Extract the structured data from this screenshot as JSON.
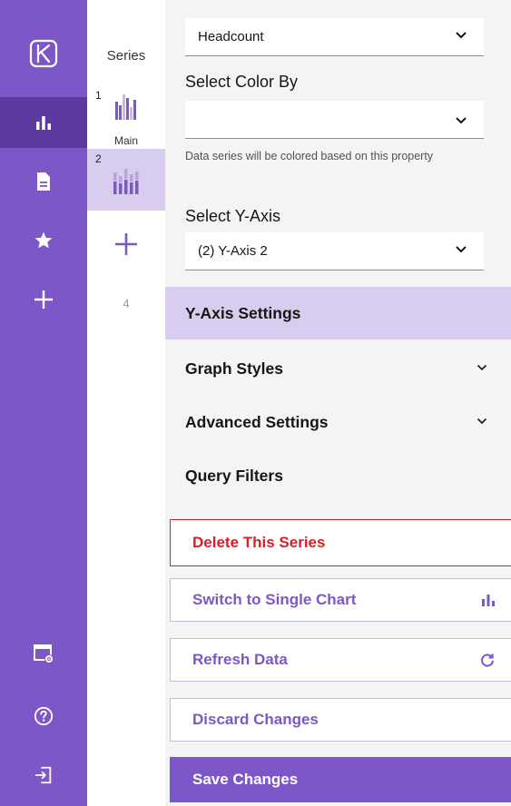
{
  "series_panel": {
    "title": "Series",
    "items": [
      {
        "number": "1",
        "sublabel": "Main",
        "icon": "bar-chart-thumbnail-icon"
      },
      {
        "number": "2",
        "sublabel": "",
        "icon": "bar-chart-thumbnail-icon"
      }
    ],
    "next_number": "4"
  },
  "settings": {
    "metric_select": {
      "value": "Headcount"
    },
    "color_by": {
      "label": "Select Color By",
      "value": "",
      "helper": "Data series will be colored based on this property"
    },
    "y_axis": {
      "label": "Select Y-Axis",
      "value": "(2) Y-Axis 2"
    }
  },
  "sections": {
    "y_axis_settings": "Y-Axis Settings",
    "graph_styles": "Graph Styles",
    "advanced_settings": "Advanced Settings",
    "query_filters": "Query Filters"
  },
  "actions": {
    "delete": "Delete This Series",
    "switch_single": "Switch to Single Chart",
    "refresh": "Refresh Data",
    "discard": "Discard Changes",
    "save": "Save Changes"
  },
  "colors": {
    "brand_purple": "#7d57c7",
    "rail_active": "#5b3aa0",
    "selected_lavender": "#d8cdee",
    "danger_red": "#da1e28"
  }
}
